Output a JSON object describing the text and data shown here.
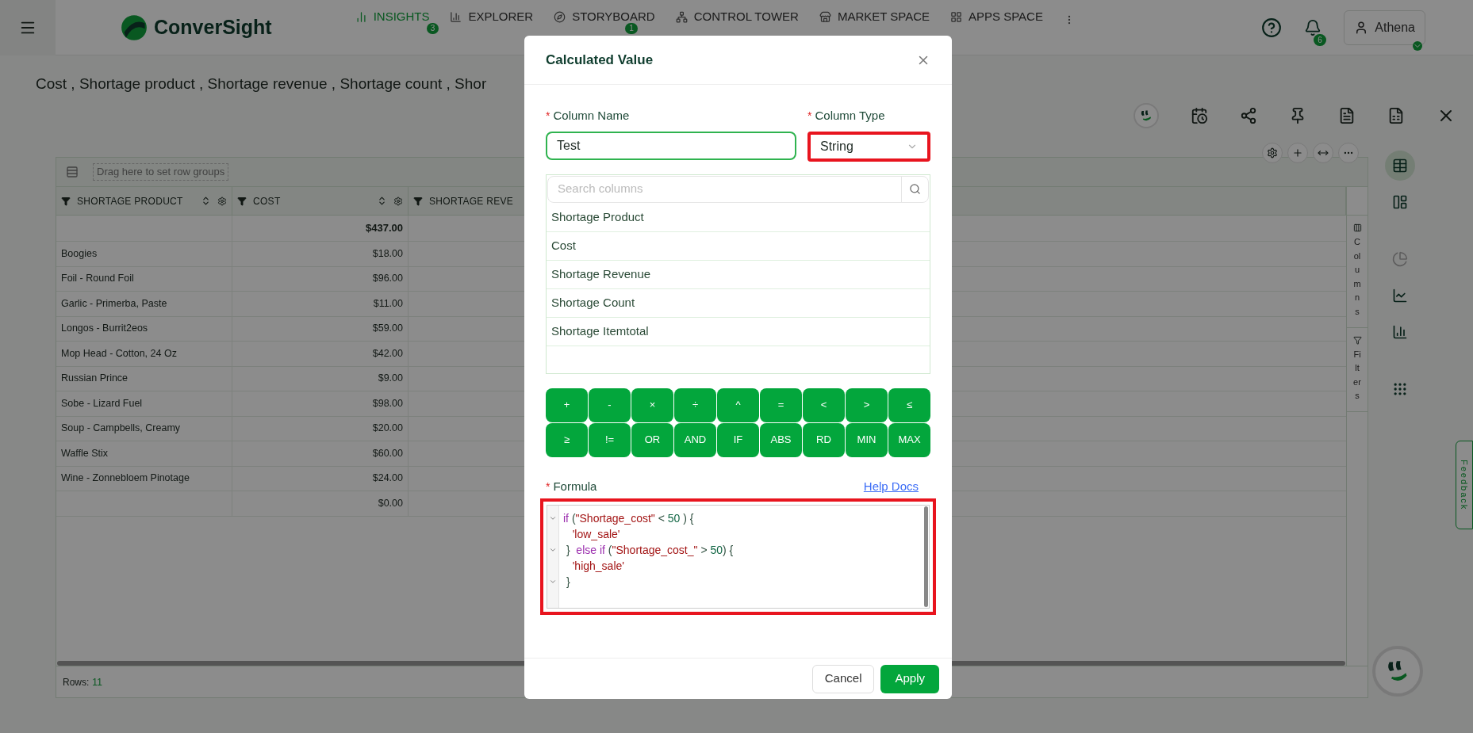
{
  "top_bar": {
    "logo": "ConverSight",
    "nav": [
      {
        "label": "INSIGHTS",
        "kind": "insights",
        "badge": "3",
        "selected": true
      },
      {
        "label": "EXPLORER",
        "kind": "explorer",
        "selected": false
      },
      {
        "label": "STORYBOARD",
        "kind": "storyboard",
        "badge": "1",
        "selected": false
      },
      {
        "label": "CONTROL TOWER",
        "kind": "tower",
        "selected": false
      },
      {
        "label": "MARKET SPACE",
        "kind": "market",
        "selected": false
      },
      {
        "label": "APPS SPACE",
        "kind": "apps",
        "selected": false
      }
    ],
    "notifications_badge": "6",
    "user": "Athena"
  },
  "page_title": "Cost , Shortage product , Shortage revenue , Shortage count , Shor",
  "table": {
    "group_bar": "Drag here to set row groups",
    "columns": [
      {
        "label": "SHORTAGE PRODUCT",
        "sortable": true
      },
      {
        "label": "COST",
        "sortable": true
      },
      {
        "label": "SHORTAGE REVE",
        "sortable": false
      }
    ],
    "total": "$437.00",
    "rows": [
      {
        "product": "Boogies",
        "cost": "$18.00"
      },
      {
        "product": "Foil - Round Foil",
        "cost": "$96.00"
      },
      {
        "product": "Garlic - Primerba, Paste",
        "cost": "$11.00"
      },
      {
        "product": "Longos - Burrit2eos",
        "cost": "$59.00"
      },
      {
        "product": "Mop Head - Cotton, 24 Oz",
        "cost": "$42.00"
      },
      {
        "product": "Russian Prince",
        "cost": "$9.00"
      },
      {
        "product": "Sobe - Lizard Fuel",
        "cost": "$98.00"
      },
      {
        "product": "Soup - Campbells, Creamy",
        "cost": "$20.00"
      },
      {
        "product": "Waffle Stix",
        "cost": "$60.00"
      },
      {
        "product": "Wine - Zonnebloem Pinotage",
        "cost": "$24.00"
      },
      {
        "cost": "$0.00"
      }
    ],
    "footer_label": "Rows:",
    "footer_count": "11",
    "side_tabs": [
      {
        "label": "Columns",
        "kind": "columns"
      },
      {
        "label": "Filters",
        "kind": "filters"
      }
    ]
  },
  "view_switcher": [
    {
      "kind": "table",
      "selected": true,
      "disabled": false
    },
    {
      "kind": "pivot",
      "selected": false,
      "disabled": false
    },
    {
      "kind": "pie",
      "selected": false,
      "disabled": true
    },
    {
      "kind": "line",
      "selected": false,
      "disabled": false
    },
    {
      "kind": "bar",
      "selected": false,
      "disabled": false
    },
    {
      "kind": "grid",
      "selected": false,
      "disabled": false
    }
  ],
  "feedback": "Feedback",
  "modal": {
    "title": "Calculated Value",
    "column_name": {
      "mark": "*",
      "label": "Column Name",
      "value": "Test"
    },
    "column_type": {
      "mark": "*",
      "label": "Column Type",
      "value": "String",
      "highlighted": true
    },
    "search": {
      "placeholder": "Search columns"
    },
    "columns": [
      "Shortage Product",
      "Cost",
      "Shortage Revenue",
      "Shortage Count",
      "Shortage Itemtotal"
    ],
    "operators": [
      "+",
      "-",
      "×",
      "÷",
      "^",
      "=",
      "<",
      ">",
      "≤",
      "≥",
      "!=",
      "OR",
      "AND",
      "IF",
      "ABS",
      "RD",
      "MIN",
      "MAX"
    ],
    "formula_mark": "*",
    "formula_label": "Formula",
    "help_link": "Help Docs",
    "formula_highlighted": true,
    "formula": [
      {
        "foldable": true,
        "tokens": [
          {
            "kind": "keyword",
            "text": "if"
          },
          {
            "kind": "punct",
            "text": " ("
          },
          {
            "kind": "string",
            "text": "\"Shortage_cost\""
          },
          {
            "kind": "punct",
            "text": " < "
          },
          {
            "kind": "number",
            "text": "50"
          },
          {
            "kind": "punct",
            "text": " ) {"
          }
        ]
      },
      {
        "foldable": false,
        "tokens": [
          {
            "kind": "string",
            "text": "   'low_sale'"
          }
        ]
      },
      {
        "foldable": true,
        "tokens": [
          {
            "kind": "punct",
            "text": " }  "
          },
          {
            "kind": "keyword",
            "text": "else if"
          },
          {
            "kind": "punct",
            "text": " ("
          },
          {
            "kind": "string",
            "text": "\"Shortage_cost_\""
          },
          {
            "kind": "punct",
            "text": " > "
          },
          {
            "kind": "number",
            "text": "50"
          },
          {
            "kind": "punct",
            "text": ") {"
          }
        ]
      },
      {
        "foldable": false,
        "tokens": [
          {
            "kind": "string",
            "text": "   'high_sale'"
          }
        ]
      },
      {
        "foldable": true,
        "tokens": [
          {
            "kind": "punct",
            "text": " }"
          }
        ]
      }
    ],
    "cancel": "Cancel",
    "apply": "Apply"
  }
}
